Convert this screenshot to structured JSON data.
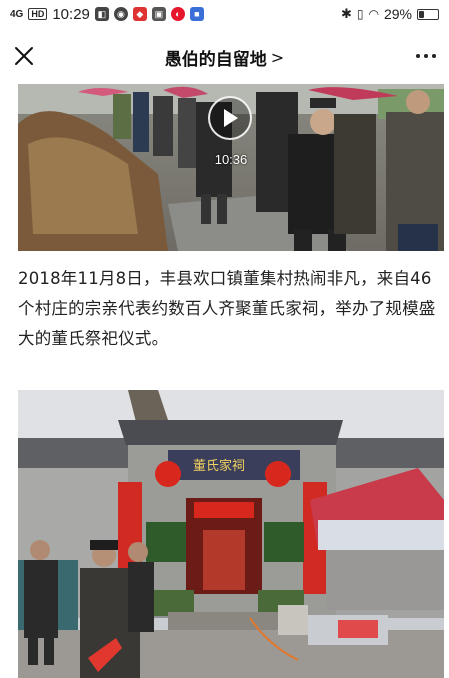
{
  "status_bar": {
    "network": "4G",
    "hd": "HD",
    "time": "10:29",
    "battery_percent": "29%",
    "battery_level": 0.29
  },
  "nav": {
    "title": "愚伯的自留地",
    "chevron": ">",
    "close_icon": "close-icon",
    "more_icon": "more-icon"
  },
  "video": {
    "duration": "10:36",
    "play_icon": "play-icon"
  },
  "article": {
    "paragraph": "2018年11月8日，丰县欢口镇董集村热闹非凡，来自46个村庄的宗亲代表约数百人齐聚董氏家祠，举办了规模盛大的董氏祭祀仪式。"
  },
  "photo": {
    "sign_text": "董氏家祠"
  }
}
